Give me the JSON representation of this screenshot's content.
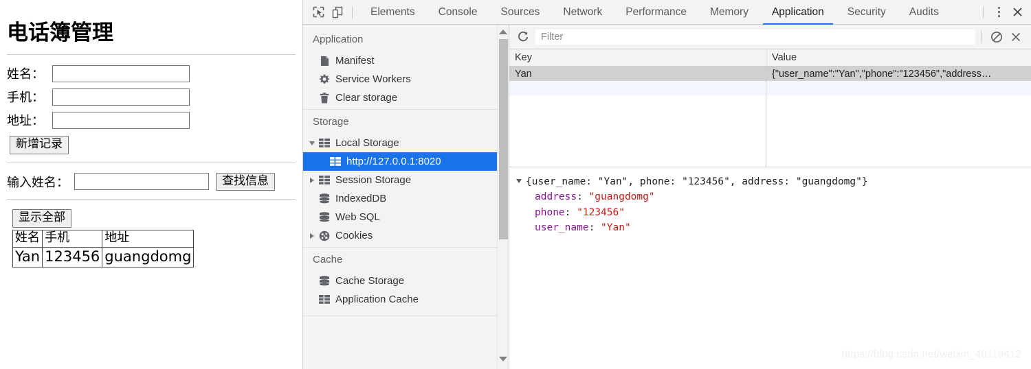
{
  "webpage": {
    "title": "电话簿管理",
    "form": {
      "fields": [
        {
          "label": "姓名：",
          "value": "",
          "placeholder": ""
        },
        {
          "label": "手机：",
          "value": "",
          "placeholder": ""
        },
        {
          "label": "地址：",
          "value": "",
          "placeholder": ""
        }
      ],
      "add_button": "新增记录"
    },
    "search": {
      "label": "输入姓名：",
      "value": "",
      "placeholder": "",
      "button": "查找信息"
    },
    "show_all_button": "显示全部",
    "table": {
      "headers": [
        "姓名",
        "手机",
        "地址"
      ],
      "rows": [
        [
          "Yan",
          "123456",
          "guangdomg"
        ]
      ]
    }
  },
  "devtools": {
    "toolbar": {
      "inspect_icon": "inspect-element-icon",
      "device_icon": "device-toolbar-icon",
      "tabs": [
        {
          "label": "Elements",
          "active": false
        },
        {
          "label": "Console",
          "active": false
        },
        {
          "label": "Sources",
          "active": false
        },
        {
          "label": "Network",
          "active": false
        },
        {
          "label": "Performance",
          "active": false
        },
        {
          "label": "Memory",
          "active": false
        },
        {
          "label": "Application",
          "active": true
        },
        {
          "label": "Security",
          "active": false
        },
        {
          "label": "Audits",
          "active": false
        }
      ],
      "more_icon": "kebab-menu-icon",
      "close_icon": "close-icon",
      "active_tab_color": "#1a73e8"
    },
    "sidebar": {
      "sections": [
        {
          "title": "Application",
          "items": [
            {
              "label": "Manifest",
              "icon": "manifest-document-icon",
              "depth": 1,
              "twisty": "none",
              "selected": false
            },
            {
              "label": "Service Workers",
              "icon": "gear-icon",
              "depth": 1,
              "twisty": "none",
              "selected": false
            },
            {
              "label": "Clear storage",
              "icon": "trash-icon",
              "depth": 1,
              "twisty": "none",
              "selected": false
            }
          ]
        },
        {
          "title": "Storage",
          "items": [
            {
              "label": "Local Storage",
              "icon": "table-grid-icon",
              "depth": 1,
              "twisty": "expanded",
              "selected": false
            },
            {
              "label": "http://127.0.0.1:8020",
              "icon": "table-grid-icon",
              "depth": 2,
              "twisty": "none",
              "selected": true
            },
            {
              "label": "Session Storage",
              "icon": "table-grid-icon",
              "depth": 1,
              "twisty": "collapsed",
              "selected": false
            },
            {
              "label": "IndexedDB",
              "icon": "database-icon",
              "depth": 1,
              "twisty": "none",
              "selected": false
            },
            {
              "label": "Web SQL",
              "icon": "database-icon",
              "depth": 1,
              "twisty": "none",
              "selected": false
            },
            {
              "label": "Cookies",
              "icon": "cookie-icon",
              "depth": 1,
              "twisty": "collapsed",
              "selected": false
            }
          ]
        },
        {
          "title": "Cache",
          "items": [
            {
              "label": "Cache Storage",
              "icon": "database-icon",
              "depth": 1,
              "twisty": "none",
              "selected": false
            },
            {
              "label": "Application Cache",
              "icon": "table-grid-icon",
              "depth": 1,
              "twisty": "none",
              "selected": false
            }
          ]
        }
      ],
      "selection_color": "#1a73e8"
    },
    "storage_panel": {
      "refresh_icon": "refresh-icon",
      "filter_placeholder": "Filter",
      "filter_value": "",
      "clear_icon": "no-entry-clear-icon",
      "delete_icon": "delete-x-icon",
      "grid": {
        "columns": [
          "Key",
          "Value"
        ],
        "rows": [
          {
            "key": "Yan",
            "value": "{\"user_name\":\"Yan\",\"phone\":\"123456\",\"address…",
            "selected": true
          }
        ]
      },
      "preview": {
        "summary": "{user_name: \"Yan\", phone: \"123456\", address: \"guangdomg\"}",
        "properties": [
          {
            "name": "address",
            "value": "\"guangdomg\""
          },
          {
            "name": "phone",
            "value": "\"123456\""
          },
          {
            "name": "user_name",
            "value": "\"Yan\""
          }
        ],
        "property_color": "#881391",
        "string_color": "#c41a16"
      }
    }
  },
  "watermark": "https://blog.csdn.net/weixin_40119412"
}
